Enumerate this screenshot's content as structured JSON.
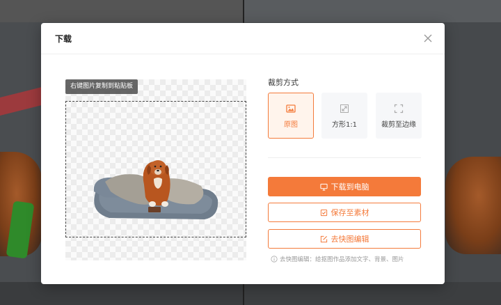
{
  "modal": {
    "title": "下载",
    "copy_tip": "右键图片复制到粘贴板",
    "crop": {
      "label": "裁剪方式",
      "options": [
        {
          "label": "原图",
          "icon": "image-icon",
          "selected": true
        },
        {
          "label": "方形1:1",
          "icon": "square-expand-icon",
          "selected": false
        },
        {
          "label": "裁剪至边缘",
          "icon": "crop-edge-icon",
          "selected": false
        }
      ]
    },
    "buttons": {
      "download_label": "下载到电脑",
      "save_label": "保存至素材",
      "edit_label": "去快图编辑"
    },
    "hint": "去快图编辑：给抠图作品添加文字、背景、图片"
  },
  "colors": {
    "accent": "#f47a3a",
    "accent_bg": "#fff4ec"
  }
}
